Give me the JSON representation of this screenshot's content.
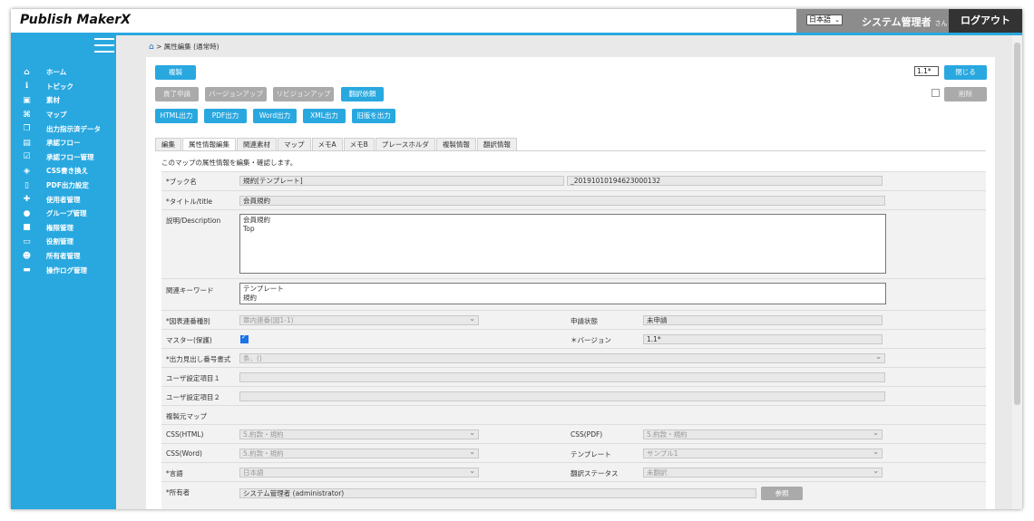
{
  "header": {
    "logo": "Publish MakerX",
    "language": "日本語",
    "user_name": "システム管理者",
    "user_suffix": "さん",
    "logout_label": "ログアウト"
  },
  "sidebar": {
    "items": [
      {
        "icon": "home-icon",
        "label": "ホーム"
      },
      {
        "icon": "info-icon",
        "label": "トピック"
      },
      {
        "icon": "image-icon",
        "label": "素材"
      },
      {
        "icon": "sitemap-icon",
        "label": "マップ"
      },
      {
        "icon": "file-export-icon",
        "label": "出力指示済データ"
      },
      {
        "icon": "clipboard-icon",
        "label": "承認フロー"
      },
      {
        "icon": "clipboard-check-icon",
        "label": "承認フロー管理"
      },
      {
        "icon": "css-icon",
        "label": "CSS書き換え"
      },
      {
        "icon": "pdf-icon",
        "label": "PDF出力設定"
      },
      {
        "icon": "user-plus-icon",
        "label": "使用者管理"
      },
      {
        "icon": "users-icon",
        "label": "グループ管理"
      },
      {
        "icon": "lock-icon",
        "label": "権限管理"
      },
      {
        "icon": "id-card-icon",
        "label": "役割管理"
      },
      {
        "icon": "user-icon",
        "label": "所有者管理"
      },
      {
        "icon": "monitor-icon",
        "label": "操作ログ管理"
      }
    ]
  },
  "breadcrumb": "> 属性編集 (通常時)",
  "toolbar": {
    "copy": "複製",
    "complete_request": "責了申請",
    "version_up": "バージョンアップ",
    "revision_up": "リビジョンアップ",
    "translation_request": "翻訳依頼",
    "html_output": "HTML出力",
    "pdf_output": "PDF出力",
    "word_output": "Word出力",
    "xml_output": "XML出力",
    "old_output": "旧版を出力",
    "version_select": "1.1*",
    "close": "閉じる",
    "delete": "削除"
  },
  "tabs": [
    "編集",
    "属性情報編集",
    "関連素材",
    "マップ",
    "メモA",
    "メモB",
    "プレースホルダ",
    "複製情報",
    "翻訳情報"
  ],
  "description": "このマップの属性情報を編集・確認します。",
  "form": {
    "book_name_label": "*ブック名",
    "book_name_value": "規約[テンプレート]",
    "book_id_value": "_20191010194623000132",
    "title_label": "*タイトル/title",
    "title_value": "会員規約",
    "desc_label": "説明/Description",
    "desc_lines": [
      "会員規約",
      "Top"
    ],
    "keyword_label": "関連キーワード",
    "keyword_lines": [
      "テンプレート",
      "規約"
    ],
    "figure_label": "*図表連番種別",
    "figure_value": "章内連番(図1-1)",
    "status_label": "申請状態",
    "status_value": "未申請",
    "master_label": "マスター(保護)",
    "version_label": "＊バージョン",
    "version_value": "1.1*",
    "heading_label": "*出力見出し番号書式",
    "heading_value": "条、()",
    "user1_label": "ユーザ設定項目１",
    "user2_label": "ユーザ設定項目２",
    "source_map_label": "複製元マップ",
    "css_html_label": "CSS(HTML)",
    "css_html_value": "5.約款・規約",
    "css_pdf_label": "CSS(PDF)",
    "css_pdf_value": "5.約款・規約",
    "css_word_label": "CSS(Word)",
    "css_word_value": "5.約款・規約",
    "template_label": "テンプレート",
    "template_value": "サンプル1",
    "lang_label": "*言語",
    "lang_value": "日本語",
    "trans_status_label": "翻訳ステータス",
    "trans_status_value": "未翻訳",
    "owner_label": "*所有者",
    "owner_value": "システム管理者 (administrator)",
    "browse": "参照"
  }
}
